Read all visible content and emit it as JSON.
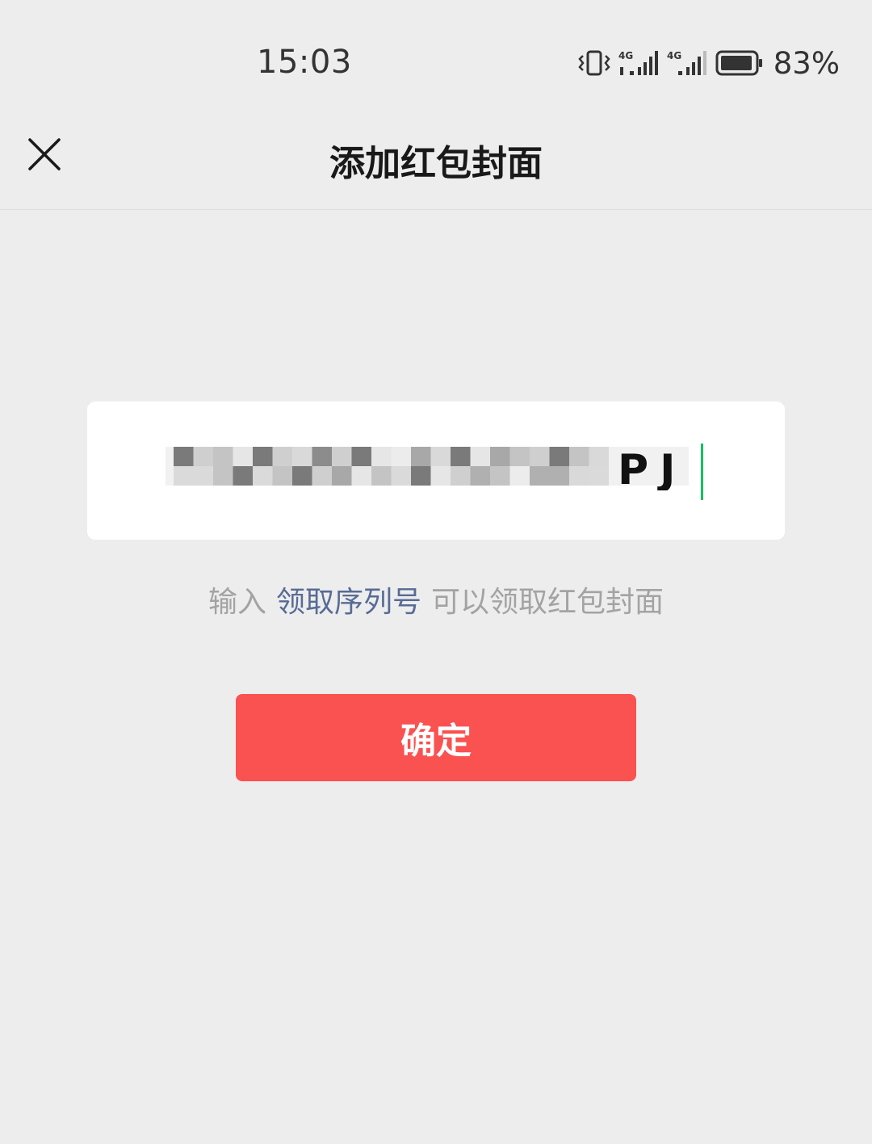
{
  "status_bar": {
    "time": "15:03",
    "battery": "83%",
    "network_1": "4G",
    "network_2": "4G",
    "icons": [
      "vibrate-icon",
      "signal-4g-icon",
      "signal-4g-icon",
      "battery-icon"
    ]
  },
  "nav": {
    "title": "添加红包封面",
    "close_icon": "close-icon"
  },
  "input": {
    "value": "S██████LEQ█████PJ",
    "visible_trailing_chars": "PJ",
    "masked": true
  },
  "hint": {
    "prefix": "输入",
    "link": "领取序列号",
    "suffix": "可以领取红包封面"
  },
  "confirm": {
    "label": "确定"
  },
  "colors": {
    "background": "#ededed",
    "card": "#ffffff",
    "confirm_button": "#fa5151",
    "link": "#576b95",
    "hint_text": "#a3a3a3",
    "cursor": "#07c160"
  }
}
